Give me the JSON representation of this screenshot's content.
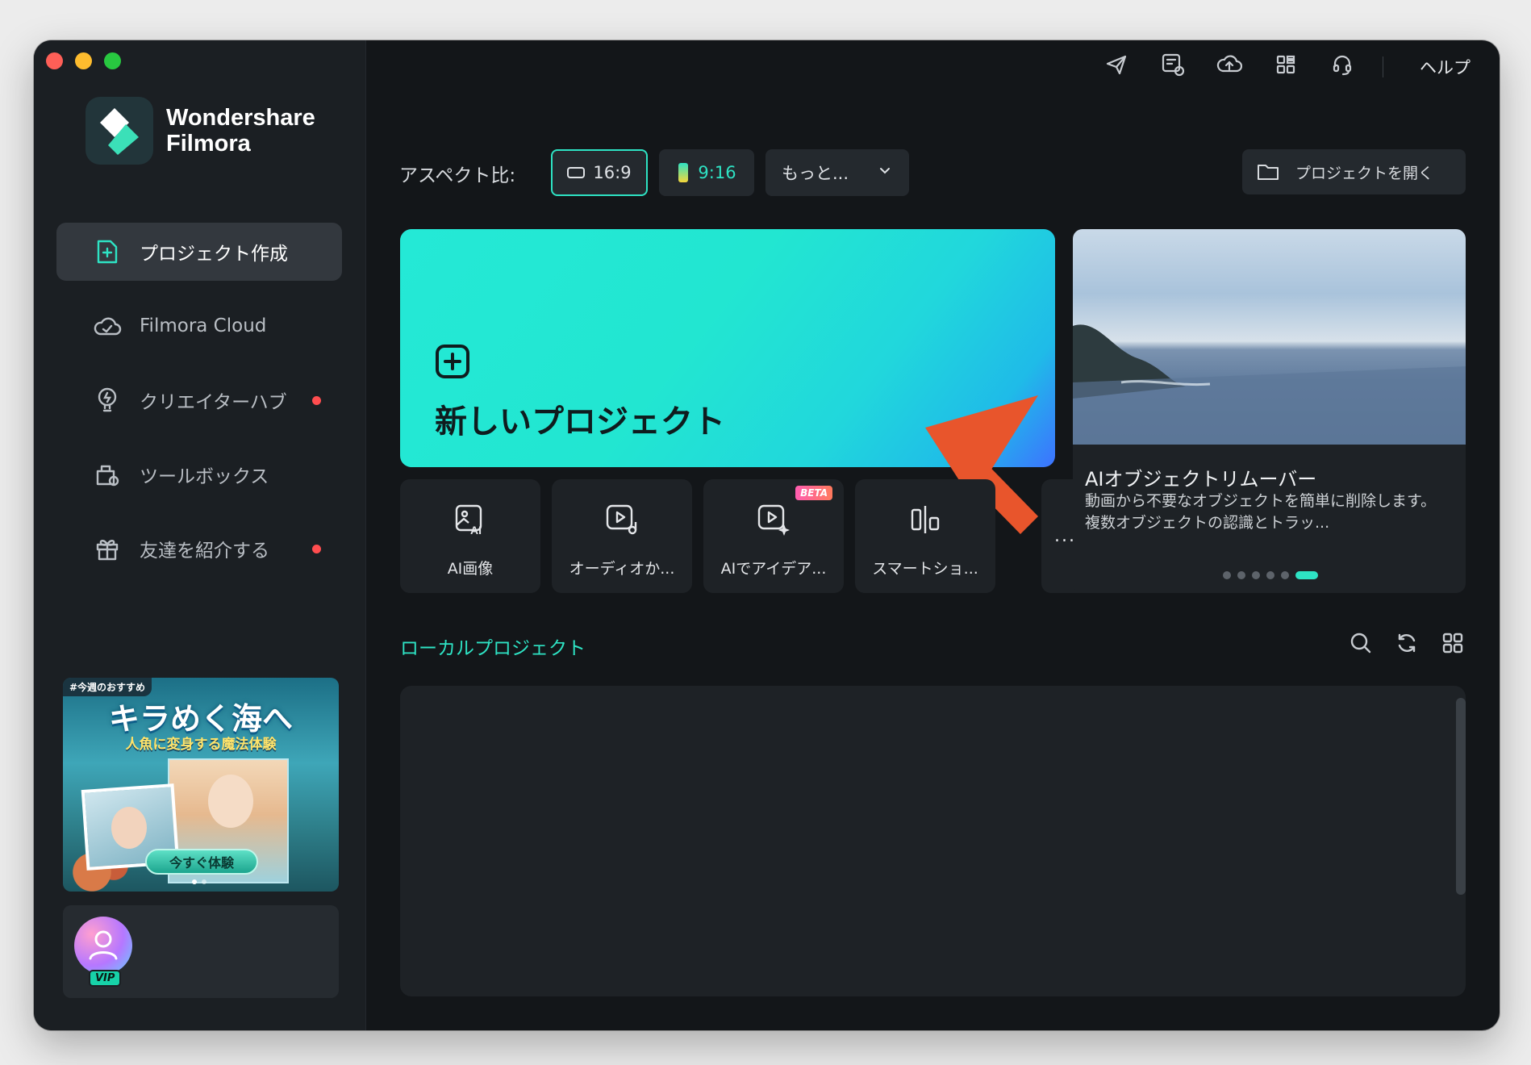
{
  "app": {
    "brand_line1": "Wondershare",
    "brand_line2": "Filmora"
  },
  "sidebar": {
    "items": [
      {
        "label": "プロジェクト作成",
        "icon": "new-project-icon",
        "active": true
      },
      {
        "label": "Filmora Cloud",
        "icon": "cloud-icon"
      },
      {
        "label": "クリエイターハブ",
        "icon": "bulb-icon",
        "dot": true
      },
      {
        "label": "ツールボックス",
        "icon": "toolbox-icon"
      },
      {
        "label": "友達を紹介する",
        "icon": "gift-icon",
        "dot": true
      }
    ],
    "promo": {
      "tag": "#今週のおすすめ",
      "title": "キラめく海へ",
      "subtitle": "人魚に変身する魔法体験",
      "button": "今すぐ体験"
    },
    "profile": {
      "badge": "VIP"
    }
  },
  "topbar": {
    "icons": [
      "send-icon",
      "feedback-icon",
      "cloud-upload-icon",
      "apps-grid-icon",
      "headset-icon"
    ],
    "help": "ヘルプ"
  },
  "aspect": {
    "label": "アスペクト比:",
    "ratio_16_9": "16:9",
    "ratio_9_16": "9:16",
    "more": "もっと...",
    "open_project": "プロジェクトを開く"
  },
  "new_project": {
    "title": "新しいプロジェクト"
  },
  "tools": [
    {
      "label": "AI画像",
      "icon": "ai-image-icon"
    },
    {
      "label": "オーディオか...",
      "icon": "audio-video-icon"
    },
    {
      "label": "AIでアイデア...",
      "icon": "ai-idea-icon",
      "badge": "BETA"
    },
    {
      "label": "スマートショ...",
      "icon": "smart-short-icon"
    }
  ],
  "tools_more": "...",
  "feature": {
    "title": "AIオブジェクトリムーバー",
    "description": "動画から不要なオブジェクトを簡単に削除します。複数オブジェクトの認識とトラッ..."
  },
  "local": {
    "title": "ローカルプロジェクト"
  },
  "colors": {
    "accent": "#2ee3c4",
    "background": "#131619",
    "sidebar": "#1b1f23",
    "annotation_arrow": "#e8552c"
  }
}
